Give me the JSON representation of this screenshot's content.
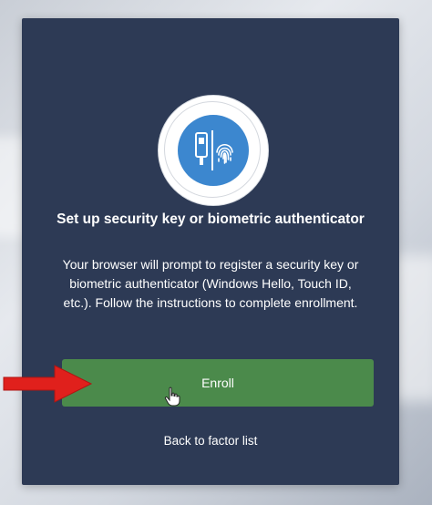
{
  "authenticator": {
    "icon": "security-key-fingerprint-icon",
    "accent_color": "#3c87cf",
    "title": "Set up security key or biometric authenticator",
    "description": "Your browser will prompt to register a security key or biometric authenticator (Windows Hello, Touch ID, etc.). Follow the instructions to complete enrollment.",
    "enroll_label": "Enroll",
    "enroll_color": "#4b8a4b",
    "back_label": "Back to factor list"
  },
  "overlay": {
    "arrow_icon": "red-arrow-icon",
    "arrow_color": "#e0201c",
    "cursor_icon": "hand-pointer-icon"
  }
}
